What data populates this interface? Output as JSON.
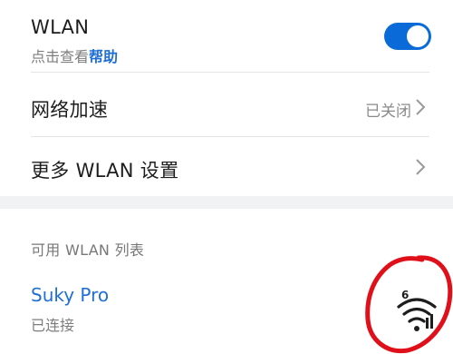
{
  "wlan": {
    "title": "WLAN",
    "subtitle_prefix": "点击查看",
    "help_link": "帮助",
    "toggle_on": true,
    "accent": "#0a6bd8"
  },
  "network_accel": {
    "label": "网络加速",
    "value": "已关闭"
  },
  "more_settings": {
    "label": "更多 WLAN 设置"
  },
  "available": {
    "header": "可用 WLAN 列表",
    "networks": [
      {
        "name": "Suky Pro",
        "status": "已连接",
        "badge": "6",
        "icon": "wifi-signal-icon"
      }
    ]
  }
}
